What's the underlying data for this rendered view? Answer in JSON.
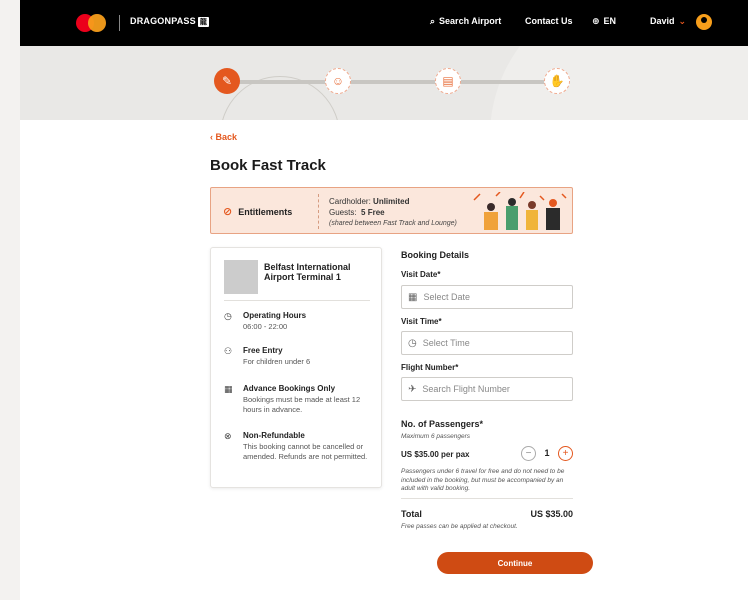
{
  "header": {
    "brand": "DRAGONPASS",
    "brand_box": "龍",
    "search_label": "Search Airport",
    "contact_label": "Contact Us",
    "lang_label": "EN",
    "user_name": "David"
  },
  "steps": [
    {
      "icon": "pencil-icon",
      "glyph": "✎",
      "state": "active"
    },
    {
      "icon": "person-icon",
      "glyph": "☺",
      "state": "pending"
    },
    {
      "icon": "document-icon",
      "glyph": "▤",
      "state": "pending"
    },
    {
      "icon": "payment-icon",
      "glyph": "✋",
      "state": "pending"
    }
  ],
  "page": {
    "back_label": "Back",
    "title": "Book Fast Track"
  },
  "entitlements": {
    "label": "Entitlements",
    "cardholder_label": "Cardholder:",
    "cardholder_value": "Unlimited",
    "guests_label": "Guests:",
    "guests_value": "5 Free",
    "note": "(shared between Fast Track and Lounge)"
  },
  "airport": {
    "name": "Belfast International Airport Terminal 1",
    "features": [
      {
        "icon": "clock-icon",
        "title": "Operating Hours",
        "desc": "06:00 - 22:00"
      },
      {
        "icon": "family-icon",
        "title": "Free Entry",
        "desc": "For children under 6"
      },
      {
        "icon": "calendar-icon",
        "title": "Advance Bookings Only",
        "desc": "Bookings must be made at least 12 hours in advance."
      },
      {
        "icon": "no-refund-icon",
        "title": "Non-Refundable",
        "desc": "This booking cannot be cancelled or amended. Refunds are not permitted."
      }
    ]
  },
  "form": {
    "heading": "Booking Details",
    "visit_date_label": "Visit Date*",
    "visit_date_placeholder": "Select Date",
    "visit_time_label": "Visit Time*",
    "visit_time_placeholder": "Select Time",
    "flight_label": "Flight Number*",
    "flight_placeholder": "Search Flight Number",
    "pax_heading": "No. of Passengers*",
    "pax_max": "Maximum 6 passengers",
    "price": "US $35.00 per pax",
    "qty": "1",
    "pax_note": "Passengers under 6 travel for free and do not need to be included in the booking, but must be accompanied by an adult with valid booking.",
    "total_label": "Total",
    "total_value": "US $35.00",
    "total_note": "Free passes can be applied at checkout.",
    "continue_label": "Continue"
  },
  "colors": {
    "accent": "#e4581f",
    "button": "#cf4b13",
    "entitlement_bg": "#fbe7dc"
  }
}
